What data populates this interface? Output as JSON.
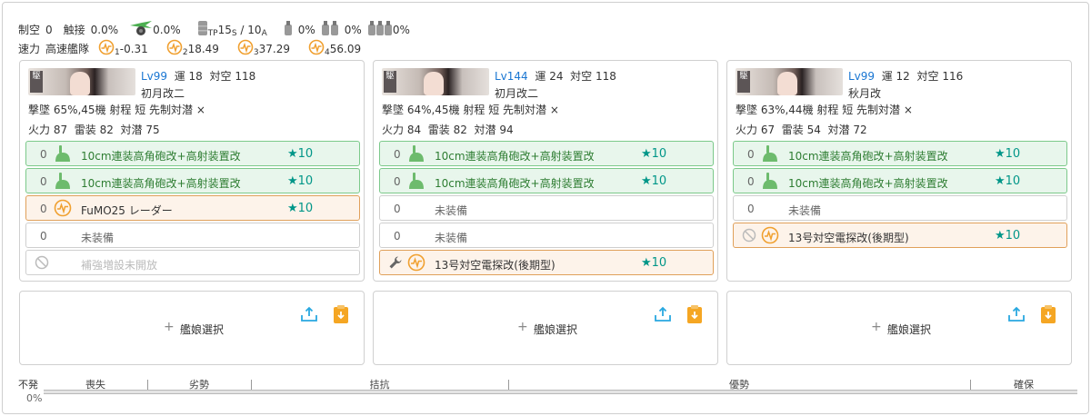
{
  "summary": {
    "air_control_label": "制空",
    "air_control_value": "0",
    "contact_label": "触接",
    "contact_value": "0.0%",
    "plane_rate": "0.0%",
    "tp_label": "TP",
    "tp_s_value": "15",
    "tp_s_sub": "S",
    "tp_sep": " / ",
    "tp_a_value": "10",
    "tp_a_sub": "A",
    "drum1_rate": "0%",
    "drum2_rate": "0%",
    "drum3_rate": "0%",
    "speed_label": "速力",
    "speed_value": "高速艦隊",
    "los": [
      {
        "sub": "1",
        "value": "-0.31"
      },
      {
        "sub": "2",
        "value": "18.49"
      },
      {
        "sub": "3",
        "value": "37.29"
      },
      {
        "sub": "4",
        "value": "56.09"
      }
    ]
  },
  "ships": [
    {
      "banner_badge": "駆",
      "level_label": "Lv99",
      "luck_label": "運",
      "luck": "18",
      "aa_label": "対空",
      "aa": "118",
      "name": "初月改二",
      "line1": "撃墜 65%,45機  射程 短  先制対潜 ×",
      "fp_label": "火力",
      "fp": "87",
      "tp_label": "雷装",
      "tp": "82",
      "asw_label": "対潜",
      "asw": "75",
      "slots": [
        {
          "count": "0",
          "label": "10cm連装高角砲改+高射装置改",
          "star": "★10",
          "type": "green",
          "icon": "gun-icon"
        },
        {
          "count": "0",
          "label": "10cm連装高角砲改+高射装置改",
          "star": "★10",
          "type": "green",
          "icon": "gun-icon"
        },
        {
          "count": "0",
          "label": "FuMO25 レーダー",
          "star": "★10",
          "type": "orange",
          "icon": "radar-icon"
        },
        {
          "count": "0",
          "label": "未装備",
          "star": "",
          "type": "empty",
          "icon": ""
        },
        {
          "count": "",
          "label": "補強増設未開放",
          "star": "",
          "type": "locked",
          "icon": "",
          "pre": "ban-icon"
        }
      ]
    },
    {
      "banner_badge": "駆",
      "level_label": "Lv144",
      "luck_label": "運",
      "luck": "24",
      "aa_label": "対空",
      "aa": "118",
      "name": "初月改二",
      "line1": "撃墜 64%,45機  射程 短  先制対潜 ×",
      "fp_label": "火力",
      "fp": "84",
      "tp_label": "雷装",
      "tp": "82",
      "asw_label": "対潜",
      "asw": "94",
      "slots": [
        {
          "count": "0",
          "label": "10cm連装高角砲改+高射装置改",
          "star": "★10",
          "type": "green",
          "icon": "gun-icon"
        },
        {
          "count": "0",
          "label": "10cm連装高角砲改+高射装置改",
          "star": "★10",
          "type": "green",
          "icon": "gun-icon"
        },
        {
          "count": "0",
          "label": "未装備",
          "star": "",
          "type": "empty",
          "icon": ""
        },
        {
          "count": "0",
          "label": "未装備",
          "star": "",
          "type": "empty",
          "icon": ""
        },
        {
          "count": "",
          "label": "13号対空電探改(後期型)",
          "star": "★10",
          "type": "orange",
          "icon": "radar-icon",
          "pre": "wrench-icon"
        }
      ]
    },
    {
      "banner_badge": "駆",
      "level_label": "Lv99",
      "luck_label": "運",
      "luck": "12",
      "aa_label": "対空",
      "aa": "116",
      "name": "秋月改",
      "line1": "撃墜 63%,44機  射程 短  先制対潜 ×",
      "fp_label": "火力",
      "fp": "67",
      "tp_label": "雷装",
      "tp": "54",
      "asw_label": "対潜",
      "asw": "72",
      "slots": [
        {
          "count": "0",
          "label": "10cm連装高角砲改+高射装置改",
          "star": "★10",
          "type": "green",
          "icon": "gun-icon"
        },
        {
          "count": "0",
          "label": "10cm連装高角砲改+高射装置改",
          "star": "★10",
          "type": "green",
          "icon": "gun-icon"
        },
        {
          "count": "0",
          "label": "未装備",
          "star": "",
          "type": "empty",
          "icon": ""
        },
        {
          "count": "",
          "label": "13号対空電探改(後期型)",
          "star": "★10",
          "type": "orange",
          "icon": "radar-icon",
          "pre": "ban-icon"
        }
      ]
    }
  ],
  "select_slots": [
    {
      "label": "艦娘選択",
      "plus": "+"
    },
    {
      "label": "艦娘選択",
      "plus": "+"
    },
    {
      "label": "艦娘選択",
      "plus": "+"
    }
  ],
  "air_bar": {
    "label_top": "不発",
    "label_bottom": "0%",
    "segments": [
      "喪失",
      "劣勢",
      "拮抗",
      "優勢",
      "確保"
    ]
  },
  "colors": {
    "level": "#1976d2",
    "star": "#009688",
    "green_slot_bg": "#e8f6ec",
    "green_slot_border": "#7cc98a",
    "orange_slot_bg": "#fdf3ea",
    "orange_slot_border": "#e0a05a",
    "upload_icon": "#29a8e0",
    "clipboard_icon": "#f5a623"
  }
}
